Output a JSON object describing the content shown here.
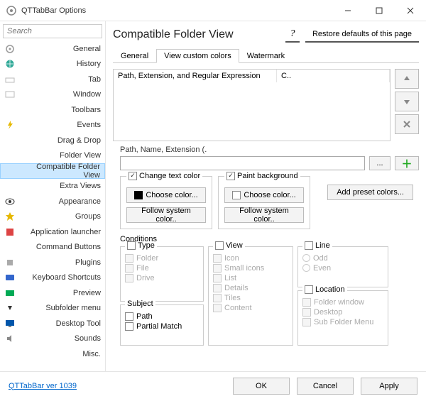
{
  "window": {
    "title": "QTTabBar Options"
  },
  "search": {
    "placeholder": "Search"
  },
  "nav": {
    "items": [
      {
        "label": "General",
        "icon": "gear",
        "color": "#999"
      },
      {
        "label": "History",
        "icon": "globe",
        "color": "#3a9"
      },
      {
        "label": "Tab",
        "icon": "tab",
        "color": "#bbb"
      },
      {
        "label": "Window",
        "icon": "window",
        "color": "#bbb"
      },
      {
        "label": "Toolbars",
        "icon": "",
        "color": ""
      },
      {
        "label": "Events",
        "icon": "bolt",
        "color": "#e6b800"
      },
      {
        "label": "Drag & Drop",
        "icon": "",
        "color": ""
      },
      {
        "label": "Folder View",
        "icon": "",
        "color": ""
      },
      {
        "label": "Compatible Folder View",
        "icon": "",
        "color": "",
        "selected": true
      },
      {
        "label": "Extra Views",
        "icon": "",
        "color": ""
      },
      {
        "label": "Appearance",
        "icon": "eye",
        "color": "#333"
      },
      {
        "label": "Groups",
        "icon": "star",
        "color": "#e6b800"
      },
      {
        "label": "Application launcher",
        "icon": "app",
        "color": "#d44"
      },
      {
        "label": "Command Buttons",
        "icon": "",
        "color": ""
      },
      {
        "label": "Plugins",
        "icon": "plugin",
        "color": "#888"
      },
      {
        "label": "Keyboard Shortcuts",
        "icon": "keyboard",
        "color": "#36c"
      },
      {
        "label": "Preview",
        "icon": "preview",
        "color": "#0a5"
      },
      {
        "label": "Subfolder menu",
        "icon": "arrow",
        "color": "#333"
      },
      {
        "label": "Desktop Tool",
        "icon": "desktop",
        "color": "#05a"
      },
      {
        "label": "Sounds",
        "icon": "sound",
        "color": "#888"
      },
      {
        "label": "Misc.",
        "icon": "",
        "color": ""
      }
    ]
  },
  "page": {
    "title": "Compatible Folder View",
    "restore": "Restore defaults of this page",
    "tabs": [
      "General",
      "View custom colors",
      "Watermark"
    ],
    "active_tab": 1,
    "list": {
      "col1": "Path, Extension, and Regular Expression",
      "col2": "C..",
      "row1_col1": "",
      "row1_col2": ""
    },
    "path_label": "Path, Name, Extension (.",
    "browse": "...",
    "change_text": "Change text color",
    "paint_bg": "Paint background",
    "choose_color": "Choose color...",
    "follow_sys": "Follow  system color..",
    "add_preset": "Add preset colors...",
    "conditions": "Conditions",
    "type": {
      "legend": "Type",
      "items": [
        "Folder",
        "File",
        "Drive"
      ]
    },
    "subject": {
      "legend": "Subject",
      "items": [
        "Path",
        "Partial Match"
      ]
    },
    "view": {
      "legend": "View",
      "items": [
        "Icon",
        "Small icons",
        "List",
        "Details",
        "Tiles",
        "Content"
      ]
    },
    "line": {
      "legend": "Line",
      "items": [
        "Odd",
        "Even"
      ]
    },
    "location": {
      "legend": "Location",
      "items": [
        "Folder window",
        "Desktop",
        "Sub Folder Menu"
      ]
    }
  },
  "footer": {
    "version": "QTTabBar ver 1039",
    "ok": "OK",
    "cancel": "Cancel",
    "apply": "Apply"
  }
}
